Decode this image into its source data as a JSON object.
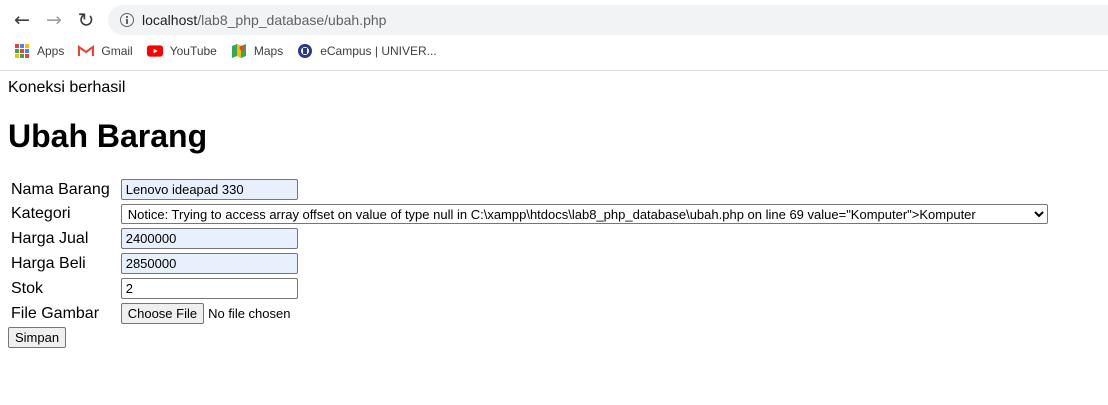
{
  "browser": {
    "url_host": "localhost",
    "url_path": "/lab8_php_database/ubah.php",
    "bookmarks": [
      {
        "label": "Apps",
        "icon": "apps-grid-icon"
      },
      {
        "label": "Gmail",
        "icon": "gmail-icon"
      },
      {
        "label": "YouTube",
        "icon": "youtube-icon"
      },
      {
        "label": "Maps",
        "icon": "maps-icon"
      },
      {
        "label": "eCampus | UNIVER...",
        "icon": "ecampus-icon"
      }
    ]
  },
  "page": {
    "status": "Koneksi berhasil",
    "title": "Ubah Barang"
  },
  "form": {
    "nama_label": "Nama Barang",
    "nama_value": "Lenovo ideapad 330",
    "kategori_label": "Kategori",
    "kategori_selected": "Notice: Trying to access array offset on value of type null in C:\\xampp\\htdocs\\lab8_php_database\\ubah.php on line 69 value=\"Komputer\">Komputer",
    "harga_jual_label": "Harga Jual",
    "harga_jual_value": "2400000",
    "harga_beli_label": "Harga Beli",
    "harga_beli_value": "2850000",
    "stok_label": "Stok",
    "stok_value": "2",
    "file_label": "File Gambar",
    "file_button": "Choose File",
    "file_status": "No file chosen",
    "submit_label": "Simpan"
  }
}
